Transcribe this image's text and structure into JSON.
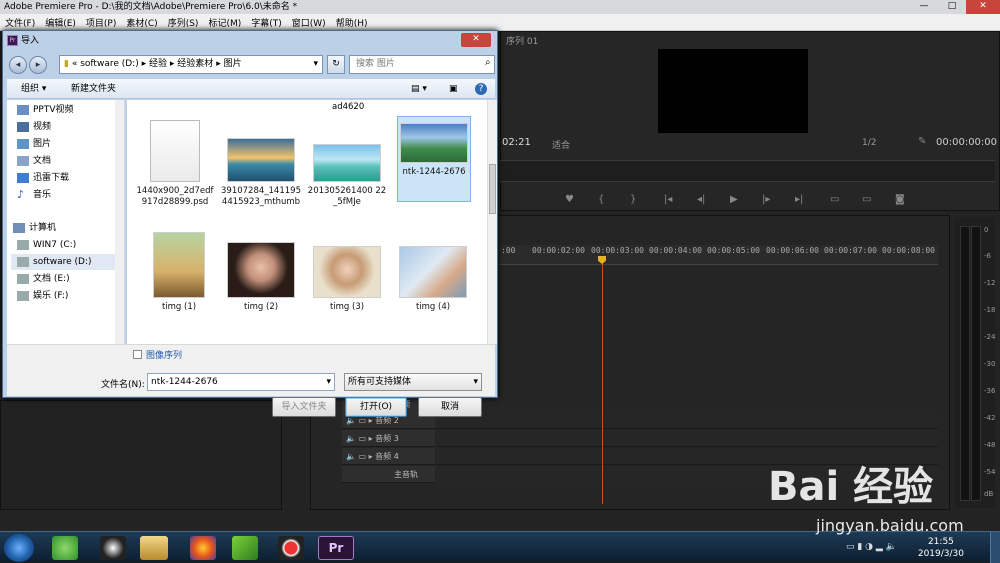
{
  "titlebar": {
    "title": "Adobe Premiere Pro - D:\\我的文档\\Adobe\\Premiere Pro\\6.0\\未命名 *",
    "min": "—",
    "max": "□",
    "close": "✕"
  },
  "menu": [
    "文件(F)",
    "编辑(E)",
    "项目(P)",
    "素材(C)",
    "序列(S)",
    "标记(M)",
    "字幕(T)",
    "窗口(W)",
    "帮助(H)"
  ],
  "premiere": {
    "sequence_tab": "序列 01",
    "monitor_time_left": "02:21",
    "monitor_fit": "适合",
    "monitor_ratio": "1/2",
    "monitor_timecode": "00:00:00:00",
    "timecodes": [
      ":00",
      "00:00:02:00",
      "00:00:03:00",
      "00:00:04:00",
      "00:00:05:00",
      "00:00:06:00",
      "00:00:07:00",
      "00:00:08:00"
    ],
    "tracks": [
      "音频",
      "音频 2",
      "音频 3",
      "音频 4",
      "主音轨"
    ],
    "meter_labels": [
      "0",
      "-6",
      "-12",
      "-18",
      "-24",
      "-30",
      "-36",
      "-42",
      "-48",
      "-54",
      "dB"
    ]
  },
  "dialog": {
    "title": "导入",
    "close": "✕",
    "address": [
      "«",
      "software (D:)",
      "▸",
      "经验",
      "▸",
      "经验素材",
      "▸",
      "图片"
    ],
    "refresh": "↻",
    "search_placeholder": "搜索 图片",
    "toolbar": {
      "organize": "组织 ▾",
      "new_folder": "新建文件夹",
      "help": "?"
    },
    "nav": {
      "items": [
        "PPTV视频",
        "视频",
        "图片",
        "文档",
        "迅雷下载",
        "音乐"
      ],
      "computer": "计算机",
      "drives": [
        "WIN7 (C:)",
        "software (D:)",
        "文档 (E:)",
        "娱乐 (F:)"
      ]
    },
    "top_partial_label": "ad4620",
    "files": [
      {
        "label": "1440x900_2d7edf917d28899.psd"
      },
      {
        "label": "39107284_1411954415923_mthumb"
      },
      {
        "label": "201305261400 22_5fMJe"
      },
      {
        "label": "ntk-1244-2676"
      },
      {
        "label": "timg (1)"
      },
      {
        "label": "timg (2)"
      },
      {
        "label": "timg (3)"
      },
      {
        "label": "timg (4)"
      }
    ],
    "image_sequence_label": "图像序列",
    "filename_label": "文件名(N):",
    "filename_value": "ntk-1244-2676",
    "filetype_value": "所有可支持媒体",
    "import_folder": "导入文件夹",
    "open": "打开(O)",
    "cancel": "取消"
  },
  "taskbar": {
    "time": "21:55",
    "date": "2019/3/30",
    "pr_label": "Pr"
  },
  "watermark": {
    "main": "Bai 经验",
    "sub": "jingyan.baidu.com"
  }
}
